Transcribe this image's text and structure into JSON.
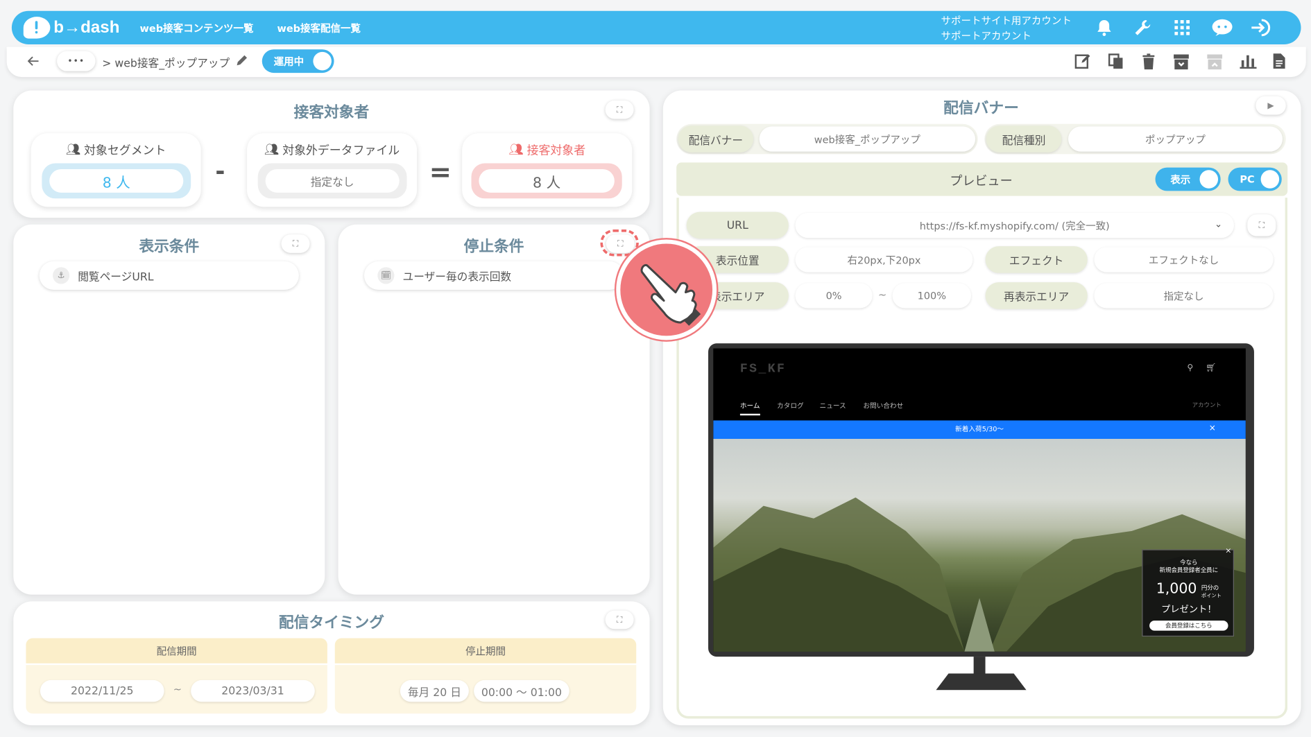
{
  "header": {
    "logo": "b→dash",
    "nav": [
      "web接客コンテンツ一覧",
      "web接客配信一覧"
    ],
    "account_line1": "サポートサイト用アカウント",
    "account_line2": "サポートアカウント",
    "accent_color": "#3fb8ee"
  },
  "toolbar": {
    "more": "•••",
    "breadcrumb": "> web接客_ポップアップ",
    "status_toggle": "運用中"
  },
  "target": {
    "title": "接客対象者",
    "segment_label": "対象セグメント",
    "segment_value": "8 人",
    "minus": "-",
    "exclude_label": "対象外データファイル",
    "exclude_value": "指定なし",
    "equals": "=",
    "result_label": "接客対象者",
    "result_value": "8 人",
    "result_color": "#ee6b6b"
  },
  "display_conditions": {
    "title": "表示条件",
    "item": "閲覧ページURL"
  },
  "stop_conditions": {
    "title": "停止条件",
    "item": "ユーザー毎の表示回数"
  },
  "timing": {
    "title": "配信タイミング",
    "period_label": "配信期間",
    "period_start": "2022/11/25",
    "period_sep": "~",
    "period_end": "2023/03/31",
    "stop_label": "停止期間",
    "stop_day": "毎月 20 日",
    "stop_time": "00:00 ～ 01:00"
  },
  "banner": {
    "title": "配信バナー",
    "banner_label": "配信バナー",
    "banner_value": "web接客_ポップアップ",
    "type_label": "配信種別",
    "type_value": "ポップアップ",
    "preview_title": "プレビュー",
    "show_toggle": "表示",
    "device_toggle": "PC",
    "url_label": "URL",
    "url_value": "https://fs-kf.myshopify.com/ (完全一致)",
    "position_label": "表示位置",
    "position_value": "右20px,下20px",
    "effect_label": "エフェクト",
    "effect_value": "エフェクトなし",
    "area_label": "表示エリア",
    "area_from": "0%",
    "area_sep": "~",
    "area_to": "100%",
    "redisplay_label": "再表示エリア",
    "redisplay_value": "指定なし"
  },
  "site_preview": {
    "logo": "FS_KF",
    "nav": [
      "ホーム",
      "カタログ",
      "ニュース",
      "お問い合わせ"
    ],
    "account": "アカウント",
    "announcement": "新着入荷5/30～",
    "close": "×",
    "popup_line1": "今なら",
    "popup_line2": "新規会員登録者全員に",
    "popup_amount": "1,000",
    "popup_unit": "円分の",
    "popup_unit2": "ポイント",
    "popup_line3": "プレゼント！",
    "popup_button": "会員登録はこちら"
  }
}
